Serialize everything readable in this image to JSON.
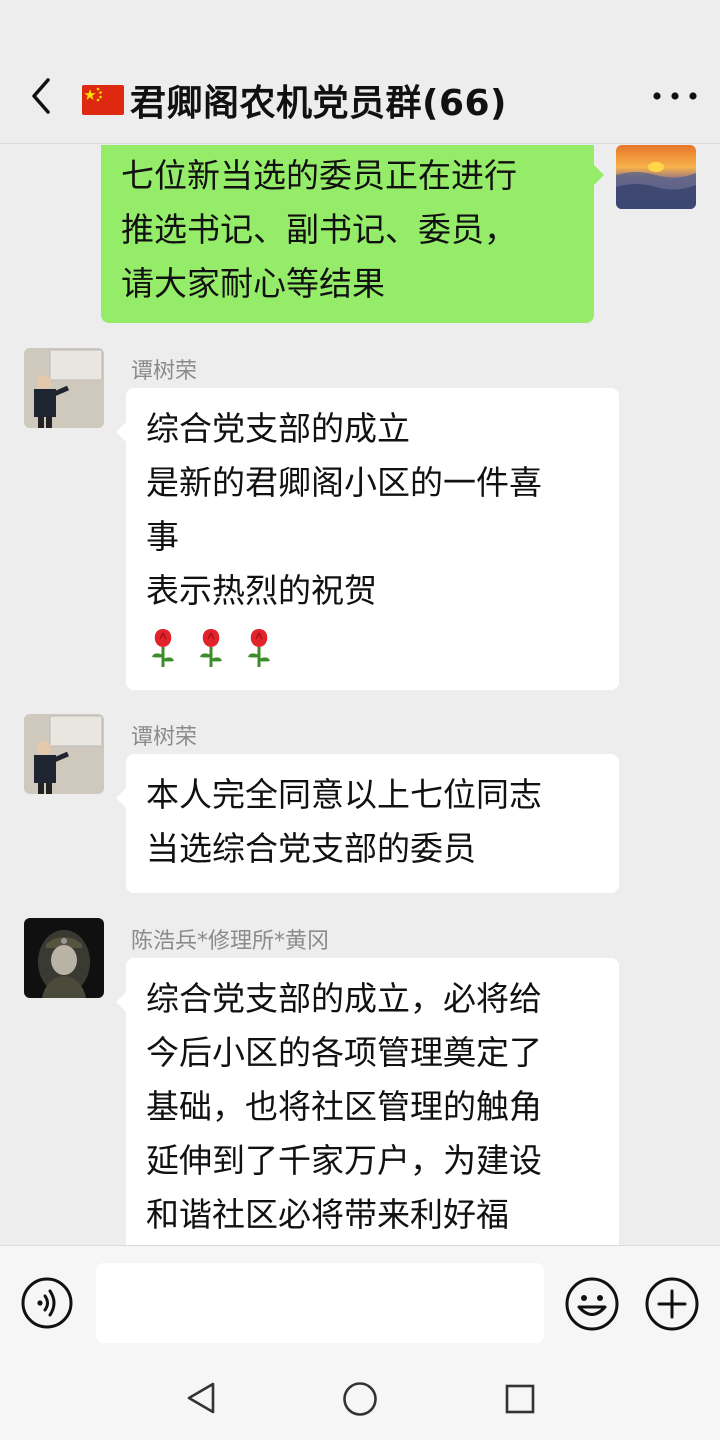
{
  "status_bar": {
    "left_text": "",
    "right_text": ""
  },
  "header": {
    "title": "君卿阁农机党员群(66)"
  },
  "messages": [
    {
      "direction": "outgoing",
      "lines": [
        "七位新当选的委员正在进行",
        "推选书记、副书记、委员，",
        "请大家耐心等结果"
      ]
    },
    {
      "direction": "incoming",
      "sender": "谭树荣",
      "lines": [
        "综合党支部的成立",
        "是新的君卿阁小区的一件喜",
        "事",
        "表示热烈的祝贺"
      ],
      "emoji": [
        "rose-icon",
        "rose-icon",
        "rose-icon"
      ]
    },
    {
      "direction": "incoming",
      "sender": "谭树荣",
      "lines": [
        "本人完全同意以上七位同志",
        "当选综合党支部的委员"
      ]
    },
    {
      "direction": "incoming",
      "sender": "陈浩兵*修理所*黄冈",
      "lines": [
        "综合党支部的成立，必将给",
        "今后小区的各项管理奠定了",
        "基础，也将社区管理的触角",
        "延伸到了千家万户，为建设",
        "和谐社区必将带来利好福"
      ]
    }
  ],
  "input": {
    "value": "",
    "placeholder": ""
  },
  "colors": {
    "background": "#ededed",
    "outgoing_bubble": "#95ec69",
    "incoming_bubble": "#ffffff",
    "sender_name": "#8b8b8b"
  }
}
